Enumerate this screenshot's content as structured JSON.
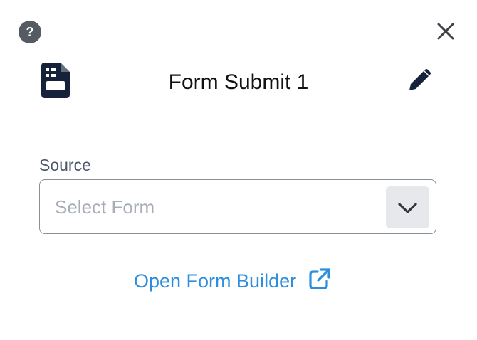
{
  "header": {
    "title": "Form Submit 1",
    "help_icon": "question-circle-icon",
    "close_icon": "close-icon",
    "form_icon": "form-document-icon",
    "edit_icon": "pencil-icon"
  },
  "source": {
    "label": "Source",
    "placeholder": "Select Form",
    "chevron_icon": "chevron-down-icon"
  },
  "builder_link": {
    "label": "Open Form Builder",
    "icon": "external-link-icon"
  },
  "colors": {
    "accent": "#2d8ee0",
    "icon_dark": "#16213a",
    "text": "#111111",
    "label": "#4a5468",
    "placeholder": "#a7adb6",
    "border": "#8a9099"
  }
}
